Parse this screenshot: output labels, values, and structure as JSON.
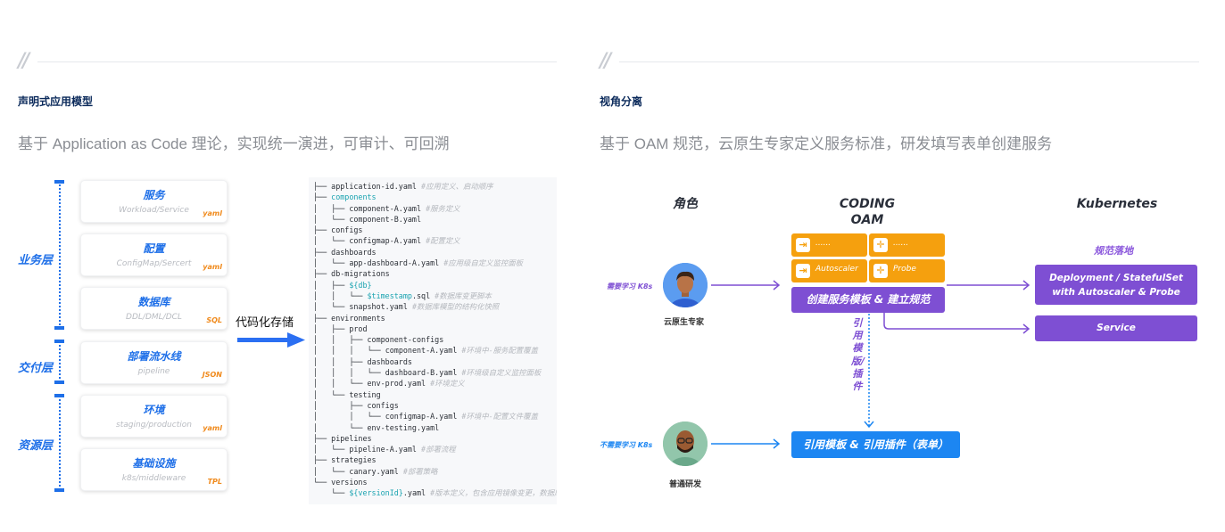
{
  "left": {
    "quote_mark": "”",
    "heading": "声明式应用模型",
    "subtitle": "基于 Application as Code 理论，实现统一演进，可审计、可回溯",
    "layers": [
      {
        "label": "业务层"
      },
      {
        "label": "交付层"
      },
      {
        "label": "资源层"
      }
    ],
    "cards": [
      {
        "name": "服务",
        "sub": "Workload/Service",
        "tag": "yaml"
      },
      {
        "name": "配置",
        "sub": "ConfigMap/Sercert",
        "tag": "yaml"
      },
      {
        "name": "数据库",
        "sub": "DDL/DML/DCL",
        "tag": "SQL"
      },
      {
        "name": "部署流水线",
        "sub": "pipeline",
        "tag": "JSON"
      },
      {
        "name": "环境",
        "sub": "staging/production",
        "tag": "yaml"
      },
      {
        "name": "基础设施",
        "sub": "k8s/middleware",
        "tag": "TPL"
      }
    ],
    "store_label": "代码化存储",
    "accent_color": "#1e6fe8",
    "tag_color": "#f08a1c",
    "code_tree": [
      {
        "prefix": "├── ",
        "name": "application-id.yaml",
        "comment": " #应用定义、启动顺序",
        "hl": false
      },
      {
        "prefix": "├── ",
        "name": "components",
        "comment": "",
        "hl": true
      },
      {
        "prefix": "│   ├── ",
        "name": "component-A.yaml",
        "comment": " #服务定义",
        "hl": false
      },
      {
        "prefix": "│   └── ",
        "name": "component-B.yaml",
        "comment": "",
        "hl": false
      },
      {
        "prefix": "├── ",
        "name": "configs",
        "comment": "",
        "hl": false
      },
      {
        "prefix": "│   └── ",
        "name": "configmap-A.yaml",
        "comment": " #配置定义",
        "hl": false
      },
      {
        "prefix": "├── ",
        "name": "dashboards",
        "comment": "",
        "hl": false
      },
      {
        "prefix": "│   └── ",
        "name": "app-dashboard-A.yaml",
        "comment": " #应用级自定义监控面板",
        "hl": false
      },
      {
        "prefix": "├── ",
        "name": "db-migrations",
        "comment": "",
        "hl": false
      },
      {
        "prefix": "│   ├── ",
        "name": "${db}",
        "comment": "",
        "hl": true
      },
      {
        "prefix": "│   │   └── ",
        "name": "$timestamp",
        "suffix": ".sql",
        "comment": " #数据库变更脚本",
        "hl": true
      },
      {
        "prefix": "│   └── ",
        "name": "snapshot.yaml",
        "comment": " #数据库模型的结构化快照",
        "hl": false
      },
      {
        "prefix": "├── ",
        "name": "environments",
        "comment": "",
        "hl": false
      },
      {
        "prefix": "│   ├── ",
        "name": "prod",
        "comment": "",
        "hl": false
      },
      {
        "prefix": "│   │   ├── ",
        "name": "component-configs",
        "comment": "",
        "hl": false
      },
      {
        "prefix": "│   │   │   └── ",
        "name": "component-A.yaml",
        "comment": " #环境中-服务配置覆盖",
        "hl": false
      },
      {
        "prefix": "│   │   ├── ",
        "name": "dashboards",
        "comment": "",
        "hl": false
      },
      {
        "prefix": "│   │   │   └── ",
        "name": "dashboard-B.yaml",
        "comment": " #环境级自定义监控面板",
        "hl": false
      },
      {
        "prefix": "│   │   └── ",
        "name": "env-prod.yaml",
        "comment": " #环境定义",
        "hl": false
      },
      {
        "prefix": "│   └── ",
        "name": "testing",
        "comment": "",
        "hl": false
      },
      {
        "prefix": "│       ├── ",
        "name": "configs",
        "comment": "",
        "hl": false
      },
      {
        "prefix": "│       │   └── ",
        "name": "configmap-A.yaml",
        "comment": " #环境中-配置文件覆盖",
        "hl": false
      },
      {
        "prefix": "│       └── ",
        "name": "env-testing.yaml",
        "comment": "",
        "hl": false
      },
      {
        "prefix": "├── ",
        "name": "pipelines",
        "comment": "",
        "hl": false
      },
      {
        "prefix": "│   └── ",
        "name": "pipeline-A.yaml",
        "comment": " #部署流程",
        "hl": false
      },
      {
        "prefix": "├── ",
        "name": "strategies",
        "comment": "",
        "hl": false
      },
      {
        "prefix": "│   └── ",
        "name": "canary.yaml",
        "comment": " #部署策略",
        "hl": false
      },
      {
        "prefix": "└── ",
        "name": "versions",
        "comment": "",
        "hl": false
      },
      {
        "prefix": "    └── ",
        "name": "${versionId}",
        "suffix": ".yaml",
        "comment": " #版本定义，包含应用镜像变更，数据库",
        "hl": true
      }
    ]
  },
  "right": {
    "quote_mark": "”",
    "heading": "视角分离",
    "subtitle": "基于 OAM 规范，云原生专家定义服务标准，研发填写表单创建服务",
    "columns": {
      "roles": "角色",
      "oam_line1": "CODING",
      "oam_line2": "OAM",
      "k8s": "Kubernetes"
    },
    "roles": [
      {
        "name": "云原生专家",
        "note": "需要学习 K8s",
        "note_color": "#7e4fd3"
      },
      {
        "name": "普通研发",
        "note": "不需要学习 K8s",
        "note_color": "#1c86f2"
      }
    ],
    "plugins": [
      {
        "icon": "autoscaler-icon",
        "label": "......"
      },
      {
        "icon": "probe-icon",
        "label": "......"
      },
      {
        "icon": "autoscaler-icon",
        "label": "Autoscaler"
      },
      {
        "icon": "probe-icon",
        "label": "Probe"
      }
    ],
    "create_template": "创建服务模板 & 建立规范",
    "reference_label": "引用模版/插件",
    "reference_form": "引用模板 & 引用插件（表单）",
    "k8s_sub": "规范落地",
    "k8s_deploy_line1": "Deployment / StatefulSet",
    "k8s_deploy_line2": "with Autoscaler & Probe",
    "k8s_service": "Service",
    "colors": {
      "purple": "#7e4fd3",
      "orange": "#f5a00e",
      "blue": "#1c86f2"
    }
  }
}
